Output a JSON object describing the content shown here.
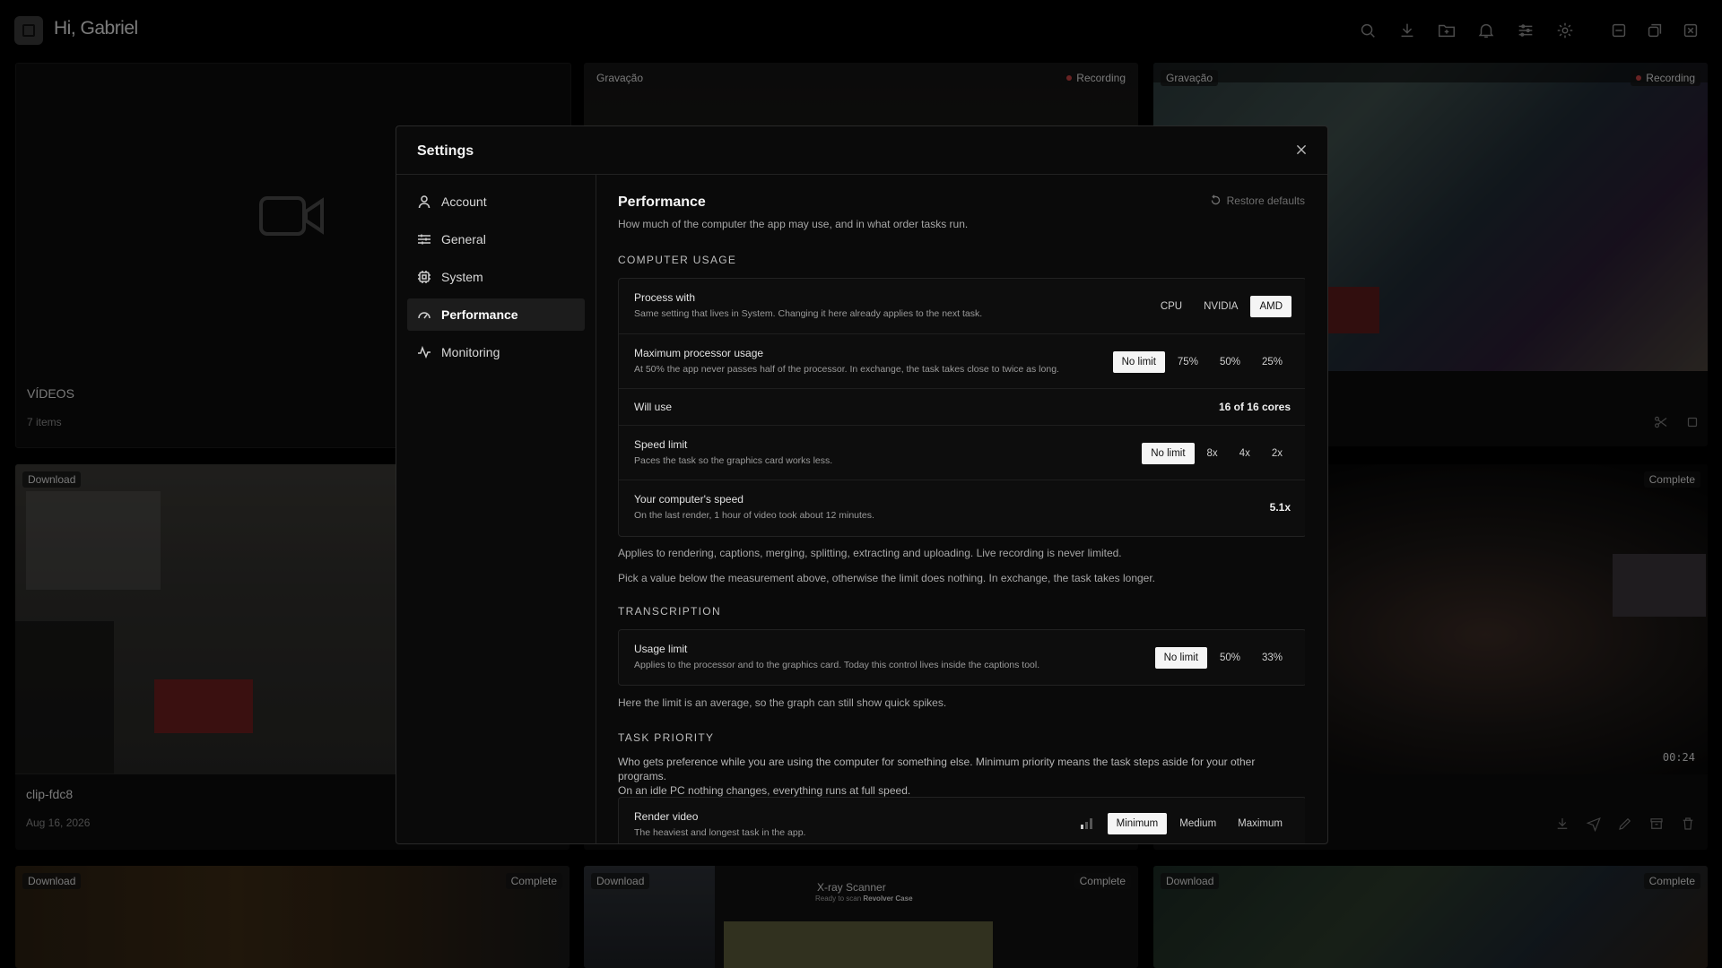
{
  "header": {
    "greeting": "Hi, Gabriel"
  },
  "top_icons": [
    "search-icon",
    "download-icon",
    "folder-icon",
    "bell-icon",
    "sliders-icon",
    "gear-icon",
    "minimize-icon",
    "restore-icon",
    "close-icon"
  ],
  "library": {
    "section_title": "VÍDEOS",
    "count": "7 items",
    "tiles": [
      {
        "badge": "Gravação",
        "status": "Recording"
      },
      {
        "badge": "Gravação",
        "status": "Recording"
      },
      {
        "badge": "Download",
        "title": "clip-fdc8",
        "date": "Aug 16, 2026"
      },
      {
        "status": "Complete",
        "duration": "00:24"
      },
      {
        "badge": "Download",
        "status": "Complete"
      },
      {
        "badge": "Download",
        "status": "Complete",
        "overlay_title": "X-ray Scanner",
        "overlay_sub": "Ready to scan",
        "overlay_sub_bold": "Revolver Case"
      },
      {
        "badge": "Download",
        "status": "Complete"
      }
    ]
  },
  "settings": {
    "title": "Settings",
    "nav": [
      {
        "label": "Account",
        "icon": "user-icon"
      },
      {
        "label": "General",
        "icon": "sliders-icon"
      },
      {
        "label": "System",
        "icon": "chip-icon"
      },
      {
        "label": "Performance",
        "icon": "gauge-icon",
        "active": true
      },
      {
        "label": "Monitoring",
        "icon": "activity-icon"
      }
    ],
    "performance": {
      "title": "Performance",
      "subtitle": "How much of the computer the app may use, and in what order tasks run.",
      "restore_label": "Restore defaults",
      "computer_usage": {
        "heading": "COMPUTER USAGE",
        "process_with": {
          "label": "Process with",
          "sub": "Same setting that lives in System. Changing it here already applies to the next task.",
          "options": [
            "CPU",
            "NVIDIA",
            "AMD"
          ],
          "selected": "AMD"
        },
        "max_processor": {
          "label": "Maximum processor usage",
          "sub": "At 50% the app never passes half of the processor. In exchange, the task takes close to twice as long.",
          "options": [
            "No limit",
            "75%",
            "50%",
            "25%"
          ],
          "selected": "No limit"
        },
        "will_use": {
          "label": "Will use",
          "value": "16 of 16 cores"
        },
        "speed_limit": {
          "label": "Speed limit",
          "sub": "Paces the task so the graphics card works less.",
          "options": [
            "No limit",
            "8x",
            "4x",
            "2x"
          ],
          "selected": "No limit"
        },
        "computer_speed": {
          "label": "Your computer's speed",
          "sub": "On the last render, 1 hour of video took about 12 minutes.",
          "value": "5.1x"
        },
        "note1": "Applies to rendering, captions, merging, splitting, extracting and uploading. Live recording is never limited.",
        "note2": "Pick a value below the measurement above, otherwise the limit does nothing. In exchange, the task takes longer."
      },
      "transcription": {
        "heading": "TRANSCRIPTION",
        "usage_limit": {
          "label": "Usage limit",
          "sub": "Applies to the processor and to the graphics card. Today this control lives inside the captions tool.",
          "options": [
            "No limit",
            "50%",
            "33%"
          ],
          "selected": "No limit"
        },
        "note": "Here the limit is an average, so the graph can still show quick spikes."
      },
      "task_priority": {
        "heading": "TASK PRIORITY",
        "desc_line1": "Who gets preference while you are using the computer for something else. Minimum priority means the task steps aside for your other programs.",
        "desc_line2": "On an idle PC nothing changes, everything runs at full speed.",
        "render_video": {
          "label": "Render video",
          "sub": "The heaviest and longest task in the app.",
          "options": [
            "Minimum",
            "Medium",
            "Maximum"
          ],
          "selected": "Minimum"
        }
      }
    }
  },
  "colors": {
    "background": "#000000",
    "modal_bg": "#0a0a0a",
    "selected_option": "#f5f5f5",
    "recording_dot": "#c04040"
  }
}
